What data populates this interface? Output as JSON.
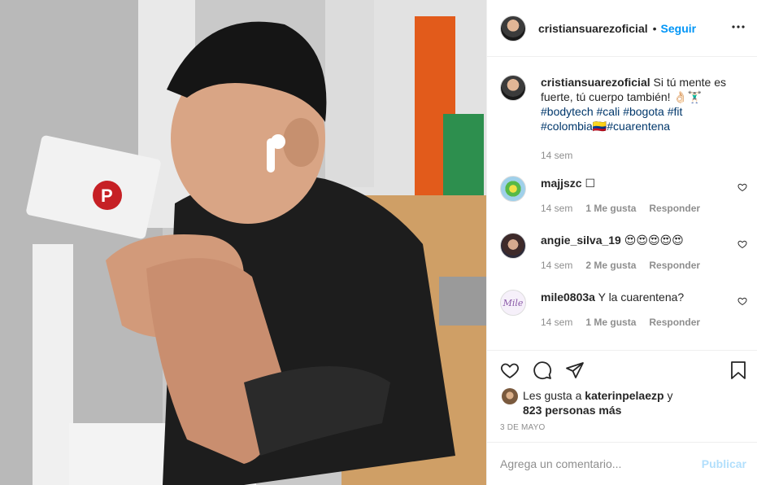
{
  "post": {
    "photo_alt": "",
    "author": {
      "username": "cristiansuarezoficial",
      "follow_label": "Seguir",
      "separator": "•",
      "more_icon": "more-horizontal-icon"
    },
    "caption": {
      "username": "cristiansuarezoficial",
      "text_pre": "Si tú mente es fuerte, tú cuerpo también! 👌🏻🏋🏻‍♂️",
      "hashtags": [
        "#bodytech",
        "#cali",
        "#bogota",
        "#fit",
        "#colombia🇨🇴",
        "#cuarentena"
      ],
      "time": "14 sem"
    },
    "comments": [
      {
        "username": "majjszc",
        "text": "☐",
        "time": "14 sem",
        "likes": "1 Me gusta",
        "reply": "Responder"
      },
      {
        "username": "angie_silva_19",
        "text": "😍😍😍😍😍",
        "time": "14 sem",
        "likes": "2 Me gusta",
        "reply": "Responder"
      },
      {
        "username": "mile0803a",
        "text": "Y la cuarentena?",
        "time": "14 sem",
        "likes": "1 Me gusta",
        "reply": "Responder",
        "avatar_text": "Mile"
      }
    ],
    "likes_summary": {
      "prefix": "Les gusta a",
      "user": "katerinpelaezp",
      "connector": "y",
      "others": "823 personas más"
    },
    "date": "3 DE MAYO",
    "comment_input": {
      "placeholder": "Agrega un comentario...",
      "publish_label": "Publicar"
    }
  },
  "colors": {
    "link_blue": "#0095f6",
    "hashtag": "#00376b",
    "muted": "#8e8e8e",
    "publish_disabled": "#b2dffc"
  }
}
